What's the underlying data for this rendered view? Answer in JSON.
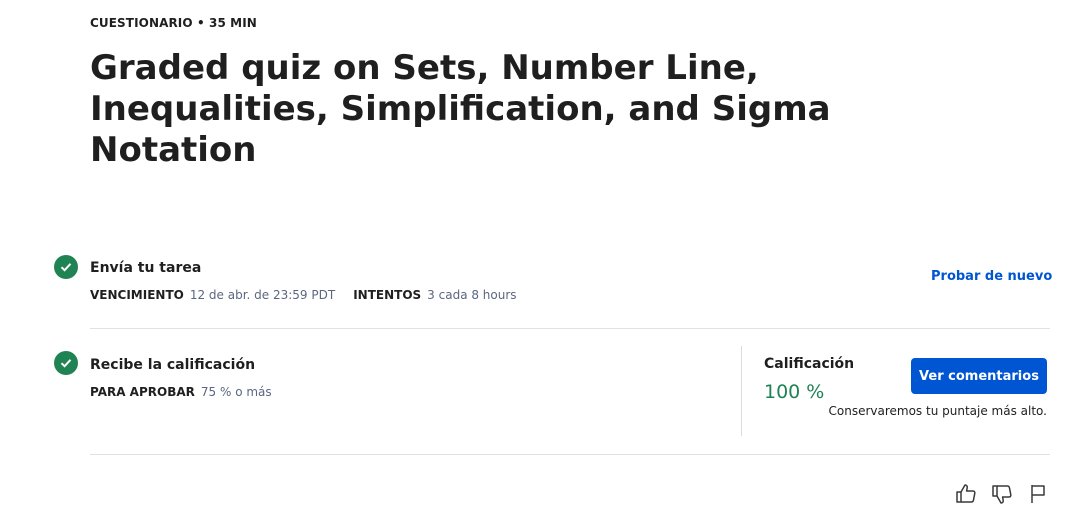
{
  "header": {
    "eyebrow": "CUESTIONARIO • 35 MIN",
    "title": "Graded quiz on Sets, Number Line, Inequalities, Simplification, and Sigma Notation"
  },
  "submit": {
    "title": "Envía tu tarea",
    "due_label": "VENCIMIENTO",
    "due_value": "12 de abr. de 23:59 PDT",
    "attempts_label": "INTENTOS",
    "attempts_value": "3 cada 8 hours",
    "retry_link": "Probar de nuevo"
  },
  "grade": {
    "title": "Recibe la calificación",
    "pass_label": "PARA APROBAR",
    "pass_value": "75 % o más",
    "grade_label": "Calificación",
    "grade_value": "100 %",
    "feedback_button": "Ver comentarios",
    "note": "Conservaremos tu puntaje más alto."
  },
  "colors": {
    "accent": "#0056d2",
    "success": "#1f8354"
  },
  "icons": {
    "step_done": "check-circle-icon",
    "like": "thumbs-up-icon",
    "dislike": "thumbs-down-icon",
    "report": "flag-icon"
  }
}
